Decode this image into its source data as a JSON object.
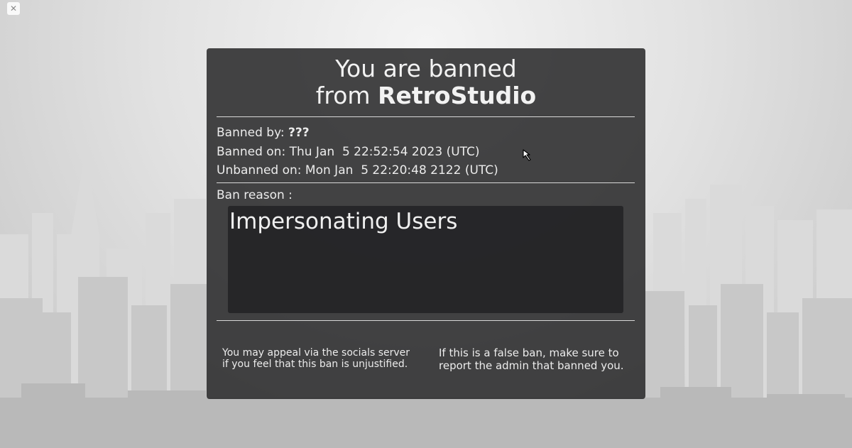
{
  "window": {
    "close_icon": "close-icon",
    "close_glyph": "✕"
  },
  "ban_panel": {
    "title_line1": "You are banned",
    "title_prefix": "from ",
    "title_game": "RetroStudio",
    "banned_by_label": "Banned by: ",
    "banned_by_value": "???",
    "banned_on": "Banned on: Thu Jan  5 22:52:54 2023 (UTC)",
    "unbanned_on": "Unbanned on: Mon Jan  5 22:20:48 2122 (UTC)",
    "reason_label": "Ban reason :",
    "reason_text": "Impersonating Users",
    "appeal_note_line1": "You may appeal via the socials server",
    "appeal_note_line2": "if you feel that this ban is unjustified.",
    "false_ban_note_line1": "If this is a false ban, make sure to",
    "false_ban_note_line2": "report the admin that banned you."
  },
  "colors": {
    "panel_bg": "#262628",
    "text": "#ededed",
    "divider": "#d8d8d8"
  }
}
